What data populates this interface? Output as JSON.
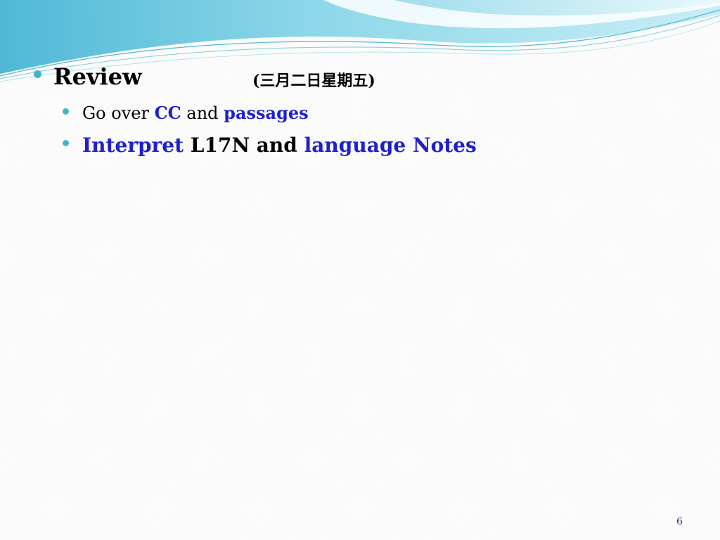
{
  "slide": {
    "title": {
      "text": "Review",
      "date": "(三月二日星期五)"
    },
    "bullets": [
      {
        "parts": [
          {
            "text": "Go over ",
            "style": "plain"
          },
          {
            "text": "CC",
            "style": "blue"
          },
          {
            "text": " and ",
            "style": "plain"
          },
          {
            "text": "passages",
            "style": "blue"
          }
        ]
      },
      {
        "parts": [
          {
            "text": "Interpret",
            "style": "blue"
          },
          {
            "text": " L17N and ",
            "style": "bold"
          },
          {
            "text": "language Notes",
            "style": "blue"
          }
        ]
      }
    ],
    "page_number": "6"
  },
  "colors": {
    "bullet": "#3cb6cf",
    "highlight_blue": "#1f1fd1",
    "wave_light": "#a8e2ee",
    "wave_mid": "#5cc3dc",
    "page_number": "#1f3d7a"
  }
}
